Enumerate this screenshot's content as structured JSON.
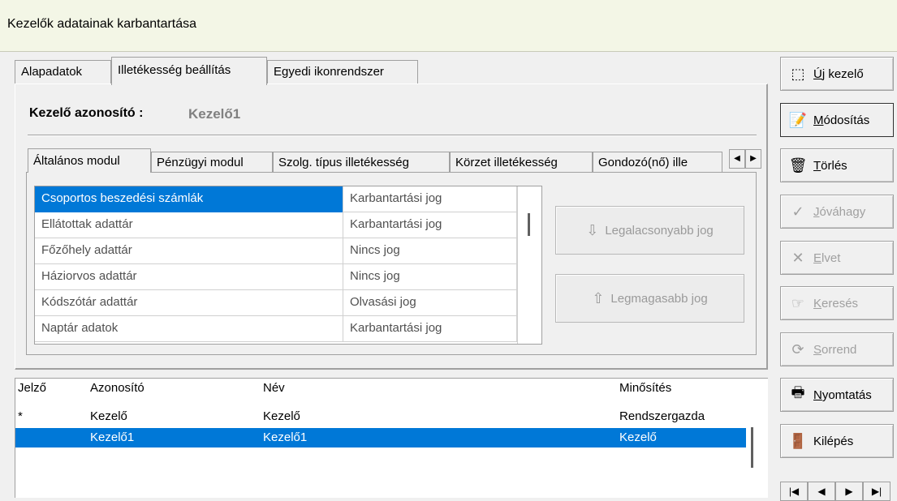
{
  "window": {
    "title": "Kezelők adatainak karbantartása"
  },
  "outer_tabs": [
    {
      "label": "Alapadatok"
    },
    {
      "label": "Illetékesség beállítás"
    },
    {
      "label": "Egyedi ikonrendszer"
    }
  ],
  "kezelo": {
    "label": "Kezelő azonosító :",
    "value": "Kezelő1"
  },
  "inner_tabs": [
    {
      "label": "Általános modul"
    },
    {
      "label": "Pénzügyi modul"
    },
    {
      "label": "Szolg. típus illetékesség"
    },
    {
      "label": "Körzet illetékesség"
    },
    {
      "label": "Gondozó(nő) ille"
    }
  ],
  "permissions": [
    {
      "name": "Csoportos beszedési számlák",
      "right": "Karbantartási jog"
    },
    {
      "name": "Ellátottak adattár",
      "right": "Karbantartási jog"
    },
    {
      "name": "Főzőhely adattár",
      "right": "Nincs jog"
    },
    {
      "name": "Háziorvos adattár",
      "right": "Nincs jog"
    },
    {
      "name": "Kódszótár adattár",
      "right": "Olvasási jog"
    },
    {
      "name": "Naptár adatok",
      "right": "Karbantartási jog"
    }
  ],
  "jog_buttons": {
    "lowest": "Legalacsonyabb jog",
    "highest": "Legmagasabb jog"
  },
  "list": {
    "headers": {
      "jelzo": "Jelző",
      "azonosito": "Azonosító",
      "nev": "Név",
      "minosites": "Minősítés"
    },
    "rows": [
      {
        "jelzo": "*",
        "azonosito": "Kezelő",
        "nev": "Kezelő",
        "minosites": "Rendszergazda"
      },
      {
        "jelzo": "",
        "azonosito": "Kezelő1",
        "nev": "Kezelő1",
        "minosites": "Kezelő"
      }
    ]
  },
  "buttons": {
    "uj_first": "Ú",
    "uj_rest": "j kezelő",
    "mod_first": "M",
    "mod_rest": "ódosítás",
    "torles_first": "T",
    "torles_rest": "örlés",
    "jovahagy_first": "J",
    "jovahagy_rest": "óváhagy",
    "elvet_first": "E",
    "elvet_rest": "lvet",
    "kereses_first": "K",
    "kereses_rest": "eresés",
    "sorrend_first": "S",
    "sorrend_rest": "orrend",
    "nyomtatas_first": "N",
    "nyomtatas_rest": "yomtatás",
    "kilepes": "Kilépés"
  },
  "colors": {
    "selection": "#0078d7",
    "titlebar": "#f3f6e6"
  }
}
